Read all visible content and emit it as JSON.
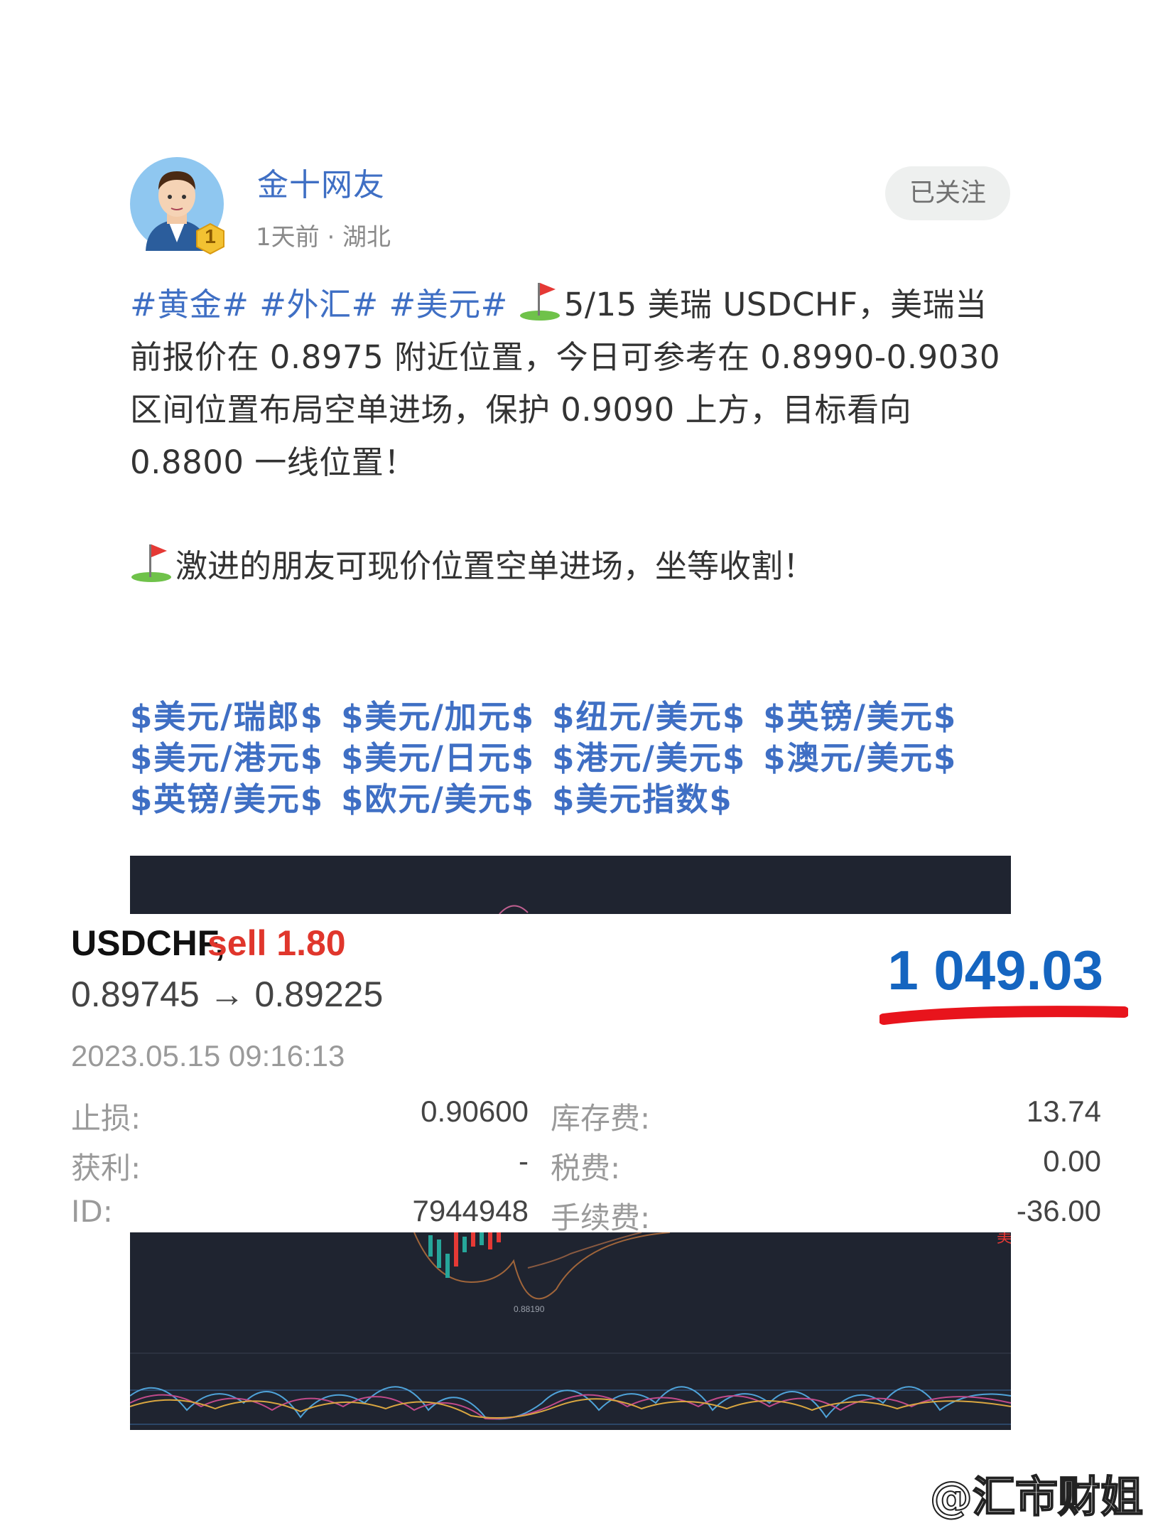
{
  "user": {
    "name": "金十网友",
    "meta": "1天前 · 湖北",
    "badge": "1",
    "follow_label": "已关注"
  },
  "post": {
    "tags": [
      "#黄金#",
      "#外汇#",
      "#美元#"
    ],
    "line1": "5/15 美瑞 USDCHF，美瑞当前报价在 0.8975 附近位置，今日可参考在 0.8990-0.9030 区间位置布局空单进场，保护 0.9090 上方，目标看向 0.8800 一线位置！",
    "line2": "激进的朋友可现价位置空单进场，坐等收割！"
  },
  "symbols": [
    "$美元/瑞郎$",
    "$美元/加元$",
    "$纽元/美元$",
    "$英镑/美元$",
    "$美元/港元$",
    "$美元/日元$",
    "$港元/美元$",
    "$澳元/美元$",
    "$英镑/美元$",
    "$欧元/美元$",
    "$美元指数$"
  ],
  "trade": {
    "symbol": "USDCHF,",
    "side": "sell 1.80",
    "prices": "0.89745 → 0.89225",
    "profit": "1 049.03",
    "timestamp": "2023.05.15 09:16:13",
    "rows": [
      {
        "label": "止损:",
        "value": "0.90600",
        "label2": "库存费:",
        "value2": "13.74"
      },
      {
        "label": "获利:",
        "value": "-",
        "label2": "税费:",
        "value2": "0.00"
      },
      {
        "label": "ID:",
        "value": "7944948",
        "label2": "手续费:",
        "value2": "-36.00"
      }
    ]
  },
  "chart": {
    "price_label": "0.88190",
    "corner_label": "美"
  },
  "watermark": "@汇市财姐",
  "colors": {
    "link": "#3f6fc4",
    "sell": "#e0362c",
    "profit": "#1565c0",
    "chart_bg": "#1f2430",
    "underline": "#e8141c"
  }
}
